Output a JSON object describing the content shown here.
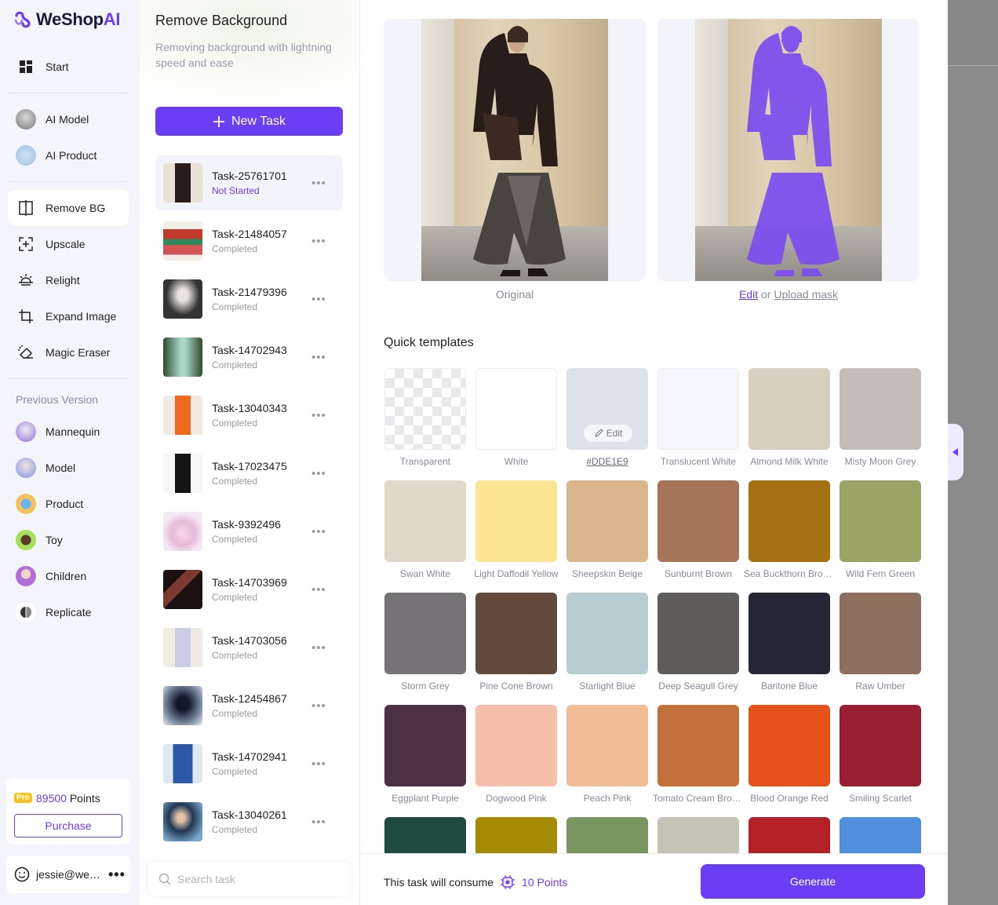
{
  "brand": {
    "name": "WeShop",
    "suffix": "AI",
    "accent": "#6b3df5"
  },
  "nav": {
    "start": "Start",
    "tools_top": [
      "AI Model",
      "AI Product"
    ],
    "tools": [
      "Remove BG",
      "Upscale",
      "Relight",
      "Expand Image",
      "Magic Eraser"
    ],
    "previous_label": "Previous Version",
    "previous": [
      "Mannequin",
      "Model",
      "Product",
      "Toy",
      "Children",
      "Replicate"
    ]
  },
  "account": {
    "badge": "Pro",
    "points_value": "89500",
    "points_word": "Points",
    "purchase": "Purchase",
    "email": "jessie@weshop.com",
    "more": "•••"
  },
  "panel": {
    "title": "Remove Background",
    "subtitle": "Removing background with lightning speed and ease",
    "new_task": "New Task",
    "search_placeholder": "Search task",
    "tasks": [
      {
        "name": "Task-25761701",
        "status": "Not Started"
      },
      {
        "name": "Task-21484057",
        "status": "Completed"
      },
      {
        "name": "Task-21479396",
        "status": "Completed"
      },
      {
        "name": "Task-14702943",
        "status": "Completed"
      },
      {
        "name": "Task-13040343",
        "status": "Completed"
      },
      {
        "name": "Task-17023475",
        "status": "Completed"
      },
      {
        "name": "Task-9392496",
        "status": "Completed"
      },
      {
        "name": "Task-14703969",
        "status": "Completed"
      },
      {
        "name": "Task-14703056",
        "status": "Completed"
      },
      {
        "name": "Task-12454867",
        "status": "Completed"
      },
      {
        "name": "Task-14702941",
        "status": "Completed"
      },
      {
        "name": "Task-13040261",
        "status": "Completed"
      }
    ],
    "more": "•••"
  },
  "preview": {
    "original_label": "Original",
    "edit": "Edit",
    "or": "or",
    "upload_mask": "Upload mask"
  },
  "templates": {
    "title": "Quick templates",
    "edit_chip": "Edit",
    "items": [
      {
        "label": "Transparent",
        "color": "transparent"
      },
      {
        "label": "White",
        "color": "#ffffff"
      },
      {
        "label": "#DDE1E9",
        "color": "#dde1e9"
      },
      {
        "label": "Translucent White",
        "color": "#f4f6fb"
      },
      {
        "label": "Almond Milk White",
        "color": "#d8cfbf"
      },
      {
        "label": "Misty Moon Grey",
        "color": "#c2bdb7"
      },
      {
        "label": "Swan White",
        "color": "#e2d8c8"
      },
      {
        "label": "Light Daffodil Yellow",
        "color": "#f9e592"
      },
      {
        "label": "Sheepskin Beige",
        "color": "#dbb58c"
      },
      {
        "label": "Sunburnt Brown",
        "color": "#a67459"
      },
      {
        "label": "Sea Buckthorn Brown",
        "color": "#a57113"
      },
      {
        "label": "Wild Fern Green",
        "color": "#9ba366"
      },
      {
        "label": "Storm Grey",
        "color": "#767376"
      },
      {
        "label": "Pine Cone Brown",
        "color": "#624a3d"
      },
      {
        "label": "Starlight Blue",
        "color": "#b8cdd2"
      },
      {
        "label": "Deep Seagull Grey",
        "color": "#5f5c5c"
      },
      {
        "label": "Baritone Blue",
        "color": "#252736"
      },
      {
        "label": "Raw Umber",
        "color": "#8e6e5e"
      },
      {
        "label": "Eggplant Purple",
        "color": "#4c3146"
      },
      {
        "label": "Dogwood Pink",
        "color": "#f6bfab"
      },
      {
        "label": "Peach Pink",
        "color": "#f0bd96"
      },
      {
        "label": "Tomato Cream Brown",
        "color": "#c2713a"
      },
      {
        "label": "Blood Orange Red",
        "color": "#e5531b"
      },
      {
        "label": "Smiling Scarlet",
        "color": "#9a1e31"
      },
      {
        "label": "",
        "color": "#1f4a3f"
      },
      {
        "label": "",
        "color": "#a58a06"
      },
      {
        "label": "",
        "color": "#799560"
      },
      {
        "label": "",
        "color": "#c4c3b5"
      },
      {
        "label": "",
        "color": "#b32127"
      },
      {
        "label": "",
        "color": "#4f8fde"
      }
    ]
  },
  "footer": {
    "consume_text": "This task will consume",
    "consume_points": "10 Points",
    "generate": "Generate"
  }
}
